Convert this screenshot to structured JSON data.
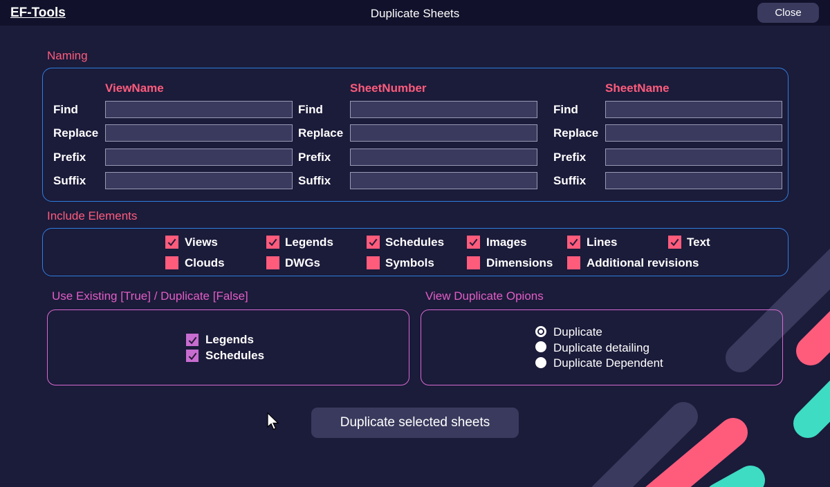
{
  "window": {
    "app_name": "EF-Tools",
    "title": "Duplicate Sheets",
    "close_label": "Close"
  },
  "naming": {
    "label": "Naming",
    "columns": [
      {
        "header": "ViewName",
        "fields": [
          "Find",
          "Replace",
          "Prefix",
          "Suffix"
        ],
        "values": [
          "",
          "",
          "",
          ""
        ]
      },
      {
        "header": "SheetNumber",
        "fields": [
          "Find",
          "Replace",
          "Prefix",
          "Suffix"
        ],
        "values": [
          "",
          "",
          "",
          ""
        ]
      },
      {
        "header": "SheetName",
        "fields": [
          "Find",
          "Replace",
          "Prefix",
          "Suffix"
        ],
        "values": [
          "",
          "",
          "",
          ""
        ]
      }
    ]
  },
  "include_elements": {
    "label": "Include Elements",
    "items": [
      {
        "label": "Views",
        "checked": true
      },
      {
        "label": "Legends",
        "checked": true
      },
      {
        "label": "Schedules",
        "checked": true
      },
      {
        "label": "Images",
        "checked": true
      },
      {
        "label": "Lines",
        "checked": true
      },
      {
        "label": "Text",
        "checked": true
      },
      {
        "label": "Clouds",
        "checked": false
      },
      {
        "label": "DWGs",
        "checked": false
      },
      {
        "label": "Symbols",
        "checked": false
      },
      {
        "label": "Dimensions",
        "checked": false
      },
      {
        "label": "Additional revisions",
        "checked": false
      }
    ]
  },
  "use_existing": {
    "label": "Use Existing [True] / Duplicate [False]",
    "items": [
      {
        "label": "Legends",
        "checked": true
      },
      {
        "label": "Schedules",
        "checked": true
      }
    ]
  },
  "view_duplicate": {
    "label": "View Duplicate Opions",
    "options": [
      {
        "label": "Duplicate",
        "selected": true
      },
      {
        "label": "Duplicate detailing",
        "selected": false
      },
      {
        "label": "Duplicate Dependent",
        "selected": false
      }
    ]
  },
  "actions": {
    "duplicate_label": "Duplicate selected sheets"
  },
  "colors": {
    "background": "#1b1b3a",
    "titlebar": "#11112b",
    "accent_pink": "#ff5c7c",
    "accent_purple": "#d96bd1",
    "accent_blue": "#2d7fe0",
    "accent_teal": "#3ddcc3",
    "input_bg": "#3a3a5e"
  }
}
